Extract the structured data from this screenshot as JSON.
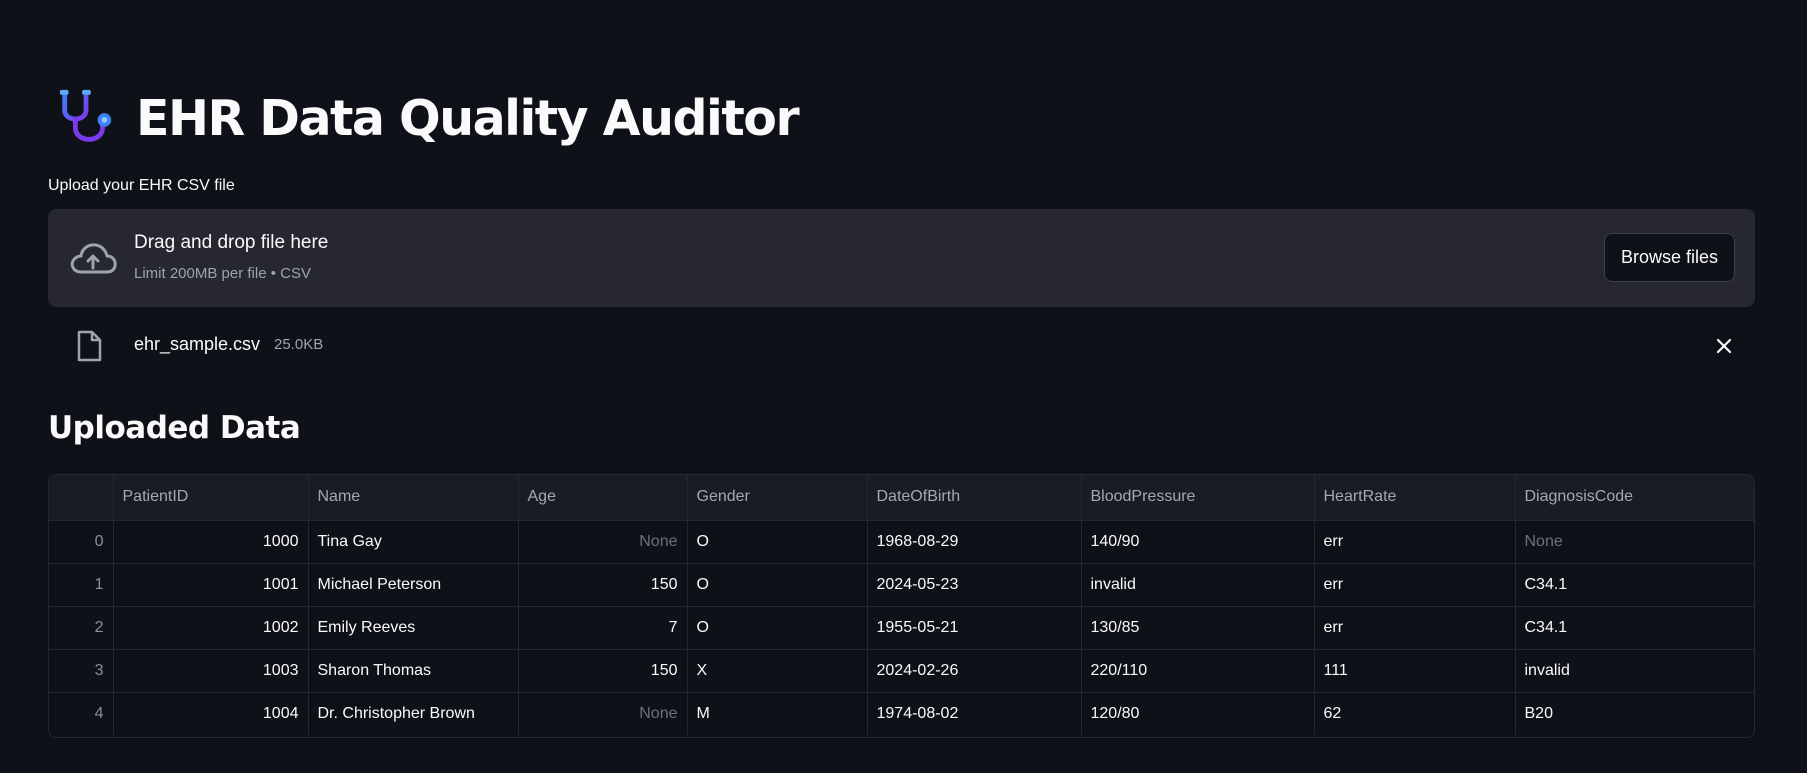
{
  "app": {
    "title": "EHR Data Quality Auditor",
    "icon": "stethoscope-icon"
  },
  "uploader": {
    "label": "Upload your EHR CSV file",
    "drop_title": "Drag and drop file here",
    "drop_subtitle": "Limit 200MB per file • CSV",
    "browse_label": "Browse files",
    "icon": "cloud-upload-icon"
  },
  "uploaded_file": {
    "name": "ehr_sample.csv",
    "size": "25.0KB",
    "icon": "file-icon",
    "remove_icon": "close-icon"
  },
  "section": {
    "heading": "Uploaded Data"
  },
  "table": {
    "columns": [
      "",
      "PatientID",
      "Name",
      "Age",
      "Gender",
      "DateOfBirth",
      "BloodPressure",
      "HeartRate",
      "DiagnosisCode"
    ],
    "rows": [
      [
        "0",
        "1000",
        "Tina Gay",
        "None",
        "O",
        "1968-08-29",
        "140/90",
        "err",
        "None"
      ],
      [
        "1",
        "1001",
        "Michael Peterson",
        "150",
        "O",
        "2024-05-23",
        "invalid",
        "err",
        "C34.1"
      ],
      [
        "2",
        "1002",
        "Emily Reeves",
        "7",
        "O",
        "1955-05-21",
        "130/85",
        "err",
        "C34.1"
      ],
      [
        "3",
        "1003",
        "Sharon Thomas",
        "150",
        "X",
        "2024-02-26",
        "220/110",
        "111",
        "invalid"
      ],
      [
        "4",
        "1004",
        "Dr. Christopher Brown",
        "None",
        "M",
        "1974-08-02",
        "120/80",
        "62",
        "B20"
      ]
    ]
  },
  "colors": {
    "background": "#0e1117",
    "panel": "#262730",
    "text": "#fafafa",
    "muted": "#9ea3ad",
    "null_text": "#6d717a"
  }
}
